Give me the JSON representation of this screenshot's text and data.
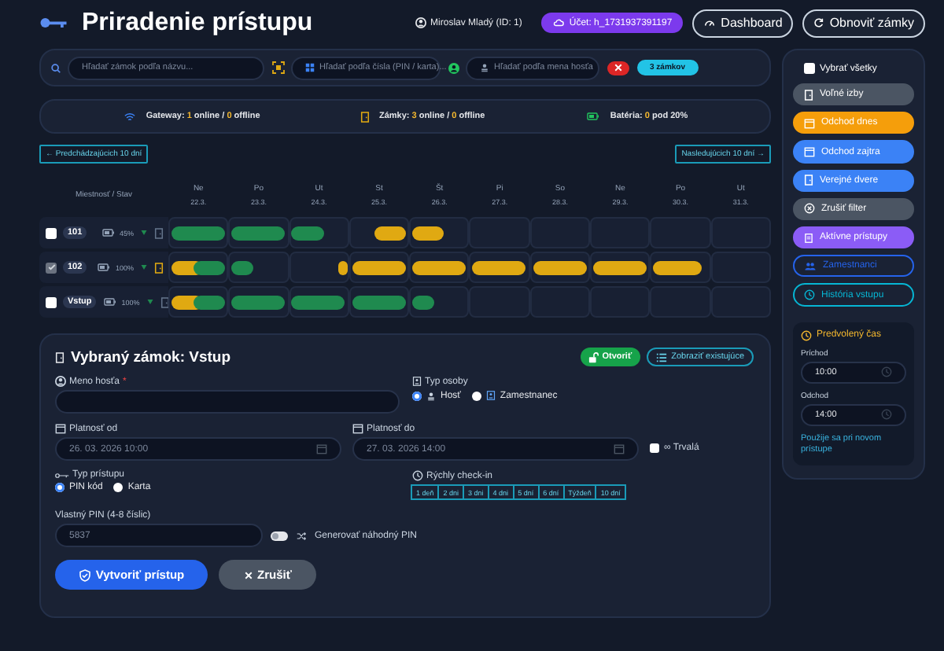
{
  "header": {
    "title": "Priradenie prístupu",
    "user": "Miroslav Mladý (ID: 1)",
    "account": "Účet: h_1731937391197",
    "buttons": [
      {
        "label": "Dashboard"
      },
      {
        "label": "Obnoviť zámky"
      }
    ]
  },
  "search": {
    "fields": [
      {
        "placeholder": "Hľadať zámok podľa názvu..."
      },
      {
        "placeholder": "Hľadať podľa čísla (PIN / karta)..."
      },
      {
        "placeholder": "Hľadať podľa mena hosťa"
      }
    ],
    "count": "3 zámkov"
  },
  "status": [
    {
      "parts": [
        "Gateway: ",
        "1",
        " online / ",
        "0",
        " offline"
      ]
    },
    {
      "parts": [
        "Zámky: ",
        "3",
        " online / ",
        "0",
        " offline"
      ]
    },
    {
      "parts": [
        "Batéria: ",
        "0",
        " pod 20%"
      ]
    }
  ],
  "nav": {
    "previous": "← Predchádzajúcich 10 dní",
    "next": "Nasledujúcich 10 dní →"
  },
  "calendar": {
    "room_header": "Miestnosť / Stav",
    "days": [
      {
        "name": "Ne",
        "date": "22.3."
      },
      {
        "name": "Po",
        "date": "23.3."
      },
      {
        "name": "Ut",
        "date": "24.3."
      },
      {
        "name": "St",
        "date": "25.3."
      },
      {
        "name": "Št",
        "date": "26.3."
      },
      {
        "name": "Pi",
        "date": "27.3."
      },
      {
        "name": "So",
        "date": "28.3."
      },
      {
        "name": "Ne",
        "date": "29.3."
      },
      {
        "name": "Po",
        "date": "30.3."
      },
      {
        "name": "Ut",
        "date": "31.3."
      }
    ],
    "rows": [
      {
        "room": "101",
        "checked": false,
        "battery": "45%",
        "door_open": false,
        "cells": [
          {
            "bars": [
              {
                "kind": "full",
                "color": "#1f8a4f"
              }
            ]
          },
          {
            "bars": [
              {
                "kind": "full",
                "color": "#1f8a4f"
              }
            ]
          },
          {
            "bars": [
              {
                "kind": "end",
                "color": "#1f8a4f"
              }
            ]
          },
          {
            "bars": [
              {
                "kind": "start",
                "color": "#e0a912"
              }
            ]
          },
          {
            "bars": [
              {
                "kind": "end",
                "color": "#e0a912"
              }
            ]
          },
          {},
          {},
          {},
          {},
          {}
        ]
      },
      {
        "room": "102",
        "checked": true,
        "battery": "100%",
        "door_open": true,
        "cells": [
          {
            "bars": [
              {
                "kind": "end",
                "color": "#e0a912"
              },
              {
                "kind": "start",
                "color": "#1f8a4f"
              }
            ]
          },
          {
            "bars": [
              {
                "kind": "short",
                "color": "#1f8a4f"
              }
            ]
          },
          {
            "bars": [
              {
                "kind": "dot",
                "color": "#e0a912"
              }
            ]
          },
          {
            "bars": [
              {
                "kind": "full",
                "color": "#e0a912"
              }
            ]
          },
          {
            "bars": [
              {
                "kind": "full",
                "color": "#e0a912"
              }
            ]
          },
          {
            "bars": [
              {
                "kind": "full",
                "color": "#e0a912"
              }
            ]
          },
          {
            "bars": [
              {
                "kind": "full",
                "color": "#e0a912"
              }
            ]
          },
          {
            "bars": [
              {
                "kind": "full",
                "color": "#e0a912"
              }
            ]
          },
          {
            "bars": [
              {
                "kind": "long",
                "color": "#e0a912"
              }
            ]
          },
          {}
        ]
      },
      {
        "room": "Vstup",
        "checked": false,
        "battery": "100%",
        "door_open": false,
        "cells": [
          {
            "bars": [
              {
                "kind": "end",
                "color": "#e0a912"
              },
              {
                "kind": "start",
                "color": "#1f8a4f"
              }
            ]
          },
          {
            "bars": [
              {
                "kind": "full",
                "color": "#1f8a4f"
              }
            ]
          },
          {
            "bars": [
              {
                "kind": "full",
                "color": "#1f8a4f"
              }
            ]
          },
          {
            "bars": [
              {
                "kind": "full",
                "color": "#1f8a4f"
              }
            ]
          },
          {
            "bars": [
              {
                "kind": "short",
                "color": "#1f8a4f"
              }
            ]
          },
          {},
          {},
          {},
          {},
          {}
        ]
      }
    ]
  },
  "form": {
    "title": "Vybraný zámok: Vstup",
    "open": "Otvoriť",
    "existing": "Zobraziť existujúce",
    "guest": {
      "label": "Meno hosťa",
      "required": "*"
    },
    "person_type": {
      "label": "Typ osoby",
      "options": [
        {
          "label": "Hosť",
          "selected": true
        },
        {
          "label": "Zamestnanec",
          "selected": false
        }
      ]
    },
    "valid_from": {
      "label": "Platnosť od",
      "value": "26. 03. 2026 10:00"
    },
    "valid_to": {
      "label": "Platnosť do",
      "value": "27. 03. 2026 14:00"
    },
    "permanent": {
      "label": "∞ Trvalá",
      "checked": false
    },
    "access_type": {
      "label": "Typ prístupu",
      "options": [
        {
          "label": "PIN kód",
          "selected": true
        },
        {
          "label": "Karta",
          "selected": false
        }
      ]
    },
    "quick": {
      "label": "Rýchly check-in",
      "options": [
        "1 deň",
        "2 dni",
        "3 dni",
        "4 dni",
        "5 dní",
        "6 dní",
        "Týždeň",
        "10 dní"
      ]
    },
    "pin": {
      "label": "Vlastný PIN (4-8 číslic)",
      "value": "5837"
    },
    "generate": {
      "label": "Generovať náhodný PIN",
      "on": false
    },
    "submit": "Vytvoriť prístup",
    "cancel": "Zrušiť"
  },
  "sidebar": {
    "select_all": {
      "label": "Vybrať všetky",
      "checked": false
    },
    "filters": [
      {
        "label": "Voľné izby",
        "kind": "filled",
        "color": "#4b5563"
      },
      {
        "label": "Odchod dnes",
        "kind": "filled",
        "color": "#f59e0b"
      },
      {
        "label": "Odchod zajtra",
        "kind": "filled",
        "color": "#3b82f6"
      },
      {
        "label": "Verejné dvere",
        "kind": "filled",
        "color": "#3b82f6"
      },
      {
        "label": "Zrušiť filter",
        "kind": "filled",
        "color": "#4b5563"
      },
      {
        "label": "Aktívne prístupy",
        "kind": "filled",
        "color": "#8b5cf6"
      },
      {
        "label": "Zamestnanci",
        "kind": "outline",
        "color": "#2563eb"
      },
      {
        "label": "História vstupu",
        "kind": "outline",
        "color": "#06b6d4"
      }
    ],
    "default_time": {
      "title": "Predvolený čas",
      "fields": [
        {
          "label": "Príchod",
          "value": "10:00"
        },
        {
          "label": "Odchod",
          "value": "14:00"
        }
      ],
      "note": "Použije sa pri novom prístupe"
    }
  }
}
